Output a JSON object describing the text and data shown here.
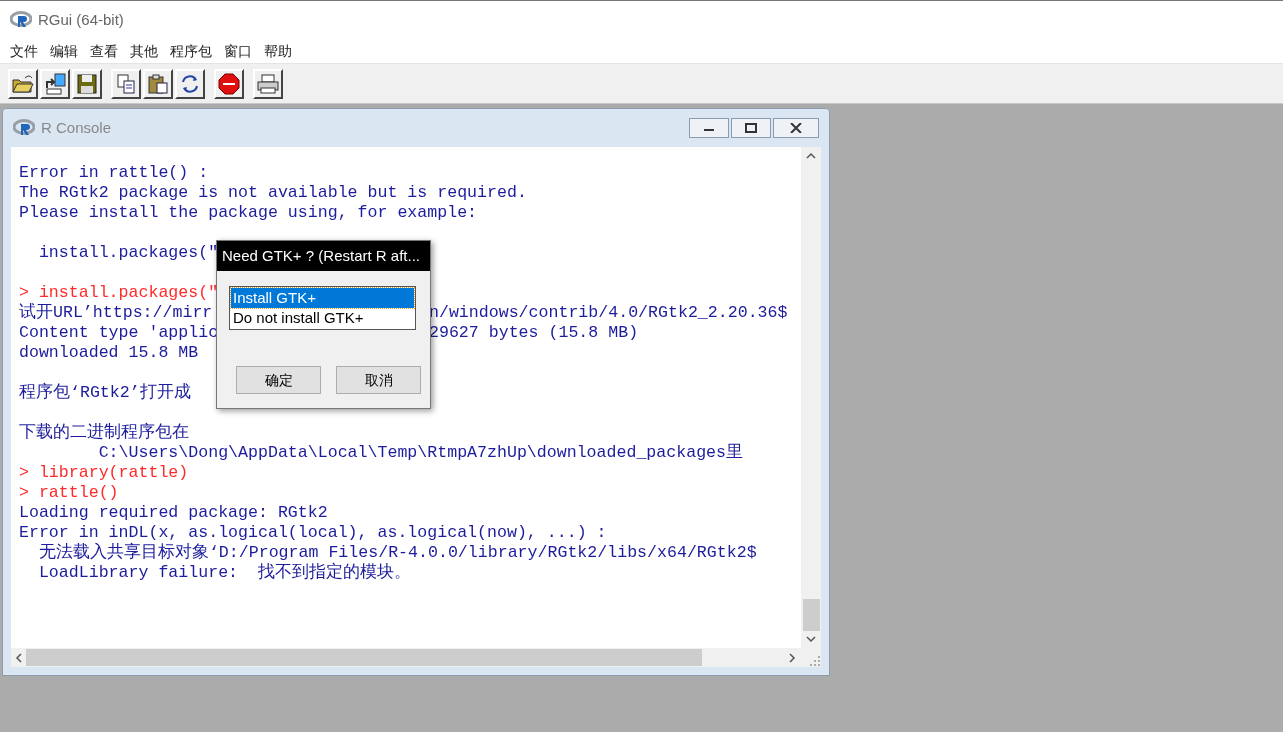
{
  "app": {
    "title": "RGui (64-bit)"
  },
  "menu": [
    "文件",
    "编辑",
    "查看",
    "其他",
    "程序包",
    "窗口",
    "帮助"
  ],
  "toolbar": [
    {
      "kind": "open"
    },
    {
      "kind": "load"
    },
    {
      "kind": "save"
    },
    {
      "kind": "copy"
    },
    {
      "kind": "paste"
    },
    {
      "kind": "refresh"
    },
    {
      "kind": "stop"
    },
    {
      "kind": "print"
    }
  ],
  "console": {
    "title": "R Console",
    "lines": [
      {
        "kind": "output",
        "text": "Error in rattle() :"
      },
      {
        "kind": "output",
        "text": "The RGtk2 package is not available but is required."
      },
      {
        "kind": "output",
        "text": "Please install the package using, for example:"
      },
      {
        "kind": "blank"
      },
      {
        "kind": "output",
        "text": "  install.packages(\""
      },
      {
        "kind": "blank"
      },
      {
        "kind": "input",
        "text": "> install.packages(\""
      },
      {
        "kind": "output",
        "text": "试开URL’https://mirr",
        "tail": "n/windows/contrib/4.0/RGtk2_2.20.36$"
      },
      {
        "kind": "output",
        "text": "Content type 'applic",
        "tail": "29627 bytes (15.8 MB)"
      },
      {
        "kind": "output",
        "text": "downloaded 15.8 MB"
      },
      {
        "kind": "blank"
      },
      {
        "kind": "output",
        "text": "程序包‘RGtk2’打开成"
      },
      {
        "kind": "blank"
      },
      {
        "kind": "output",
        "text": "下载的二进制程序包在"
      },
      {
        "kind": "output",
        "text": "        C:\\Users\\Dong\\AppData\\Local\\Temp\\RtmpA7zhUp\\downloaded_packages里"
      },
      {
        "kind": "input",
        "text": "> library(rattle)"
      },
      {
        "kind": "input",
        "text": "> rattle()"
      },
      {
        "kind": "output",
        "text": "Loading required package: RGtk2"
      },
      {
        "kind": "output",
        "text": "Error in inDL(x, as.logical(local), as.logical(now), ...) :"
      },
      {
        "kind": "output",
        "text": "  无法载入共享目标对象‘D:/Program Files/R-4.0.0/library/RGtk2/libs/x64/RGtk2$"
      },
      {
        "kind": "output",
        "text": "  LoadLibrary failure:  找不到指定的模块。"
      }
    ]
  },
  "dialog": {
    "title": "Need GTK+ ? (Restart R aft...",
    "options": [
      {
        "label": "Install GTK+",
        "selected": true
      },
      {
        "label": "Do not install GTK+",
        "selected": false
      }
    ],
    "buttons": [
      "确定",
      "取消"
    ]
  }
}
